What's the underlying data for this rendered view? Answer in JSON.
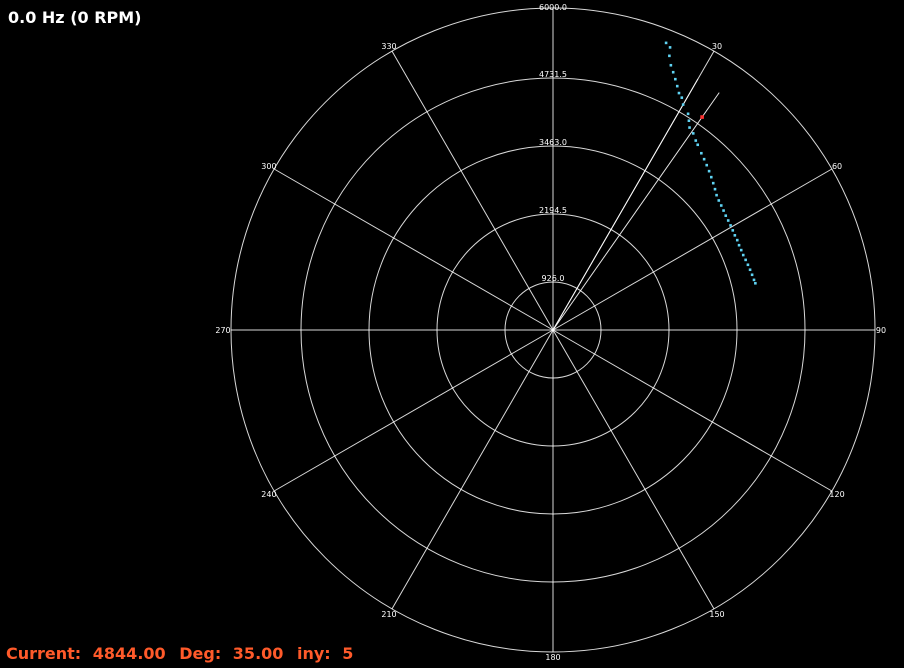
{
  "header": {
    "frequency": "0.0 Hz (0 RPM)"
  },
  "status": {
    "current_label": "Current:",
    "current_value": "4844.00",
    "deg_label": "Deg:",
    "deg_value": "35.00",
    "iny_label": "iny:",
    "iny_value": "5",
    "color": "#ff5a2a"
  },
  "chart_data": {
    "type": "scatter",
    "coordinate_system": "polar",
    "radial_ticks": [
      "926.0",
      "2194.5",
      "3463.0",
      "4731.5",
      "6000.0"
    ],
    "radial_range": [
      0,
      6000
    ],
    "angular_ticks": [
      "30",
      "60",
      "90",
      "120",
      "150",
      "180",
      "210",
      "240",
      "270",
      "300",
      "330"
    ],
    "grid": true,
    "colors": {
      "grid": "#ffffff",
      "points": "#5fd3f3",
      "marker": "#ff3030"
    },
    "series": [
      {
        "points": [
          {
            "r": 5750,
            "theta": 21.5
          },
          {
            "r": 5700,
            "theta": 22.5
          },
          {
            "r": 5550,
            "theta": 23
          },
          {
            "r": 5400,
            "theta": 24
          },
          {
            "r": 5300,
            "theta": 25
          },
          {
            "r": 5200,
            "theta": 26
          },
          {
            "r": 5100,
            "theta": 27
          },
          {
            "r": 5000,
            "theta": 28
          },
          {
            "r": 4950,
            "theta": 29
          },
          {
            "r": 4850,
            "theta": 30
          },
          {
            "r": 4750,
            "theta": 32
          },
          {
            "r": 4650,
            "theta": 33
          },
          {
            "r": 4550,
            "theta": 34
          },
          {
            "r": 4500,
            "theta": 35.5
          },
          {
            "r": 4420,
            "theta": 37
          },
          {
            "r": 4380,
            "theta": 38
          },
          {
            "r": 4300,
            "theta": 40
          },
          {
            "r": 4250,
            "theta": 41.5
          },
          {
            "r": 4200,
            "theta": 43
          },
          {
            "r": 4150,
            "theta": 44.5
          },
          {
            "r": 4100,
            "theta": 46
          },
          {
            "r": 4050,
            "theta": 47.5
          },
          {
            "r": 4000,
            "theta": 49
          },
          {
            "r": 3950,
            "theta": 50.5
          },
          {
            "r": 3920,
            "theta": 52
          },
          {
            "r": 3900,
            "theta": 53.5
          },
          {
            "r": 3880,
            "theta": 55
          },
          {
            "r": 3860,
            "theta": 56.5
          },
          {
            "r": 3850,
            "theta": 58
          },
          {
            "r": 3840,
            "theta": 59.5
          },
          {
            "r": 3830,
            "theta": 61
          },
          {
            "r": 3820,
            "theta": 62.5
          },
          {
            "r": 3820,
            "theta": 64
          },
          {
            "r": 3810,
            "theta": 65.5
          },
          {
            "r": 3810,
            "theta": 67
          },
          {
            "r": 3810,
            "theta": 68.5
          },
          {
            "r": 3820,
            "theta": 70
          },
          {
            "r": 3830,
            "theta": 71.5
          },
          {
            "r": 3840,
            "theta": 73
          },
          {
            "r": 3850,
            "theta": 74.5
          },
          {
            "r": 3860,
            "theta": 76
          },
          {
            "r": 3870,
            "theta": 77
          }
        ]
      }
    ],
    "current_marker": {
      "r": 4844,
      "theta": 35
    },
    "cursor_lines_deg": [
      30,
      35
    ]
  }
}
